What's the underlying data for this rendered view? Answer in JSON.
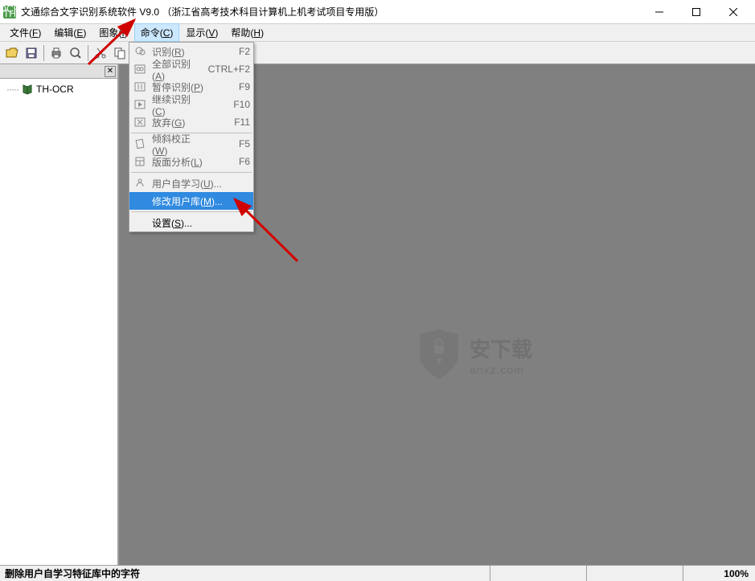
{
  "window": {
    "title": "文通综合文字识别系统软件 V9.0 （浙江省高考技术科目计算机上机考试项目专用版）"
  },
  "menu": {
    "items": [
      "文件(F)",
      "编辑(E)",
      "图象(I)",
      "命令(C)",
      "显示(V)",
      "帮助(H)"
    ],
    "active_index": 3
  },
  "dropdown": {
    "groups": [
      [
        {
          "label": "识别(R)",
          "shortcut": "F2",
          "icon": "recognize-icon"
        },
        {
          "label": "全部识别(A)",
          "shortcut": "CTRL+F2",
          "icon": "recognize-all-icon"
        },
        {
          "label": "暂停识别(P)",
          "shortcut": "F9",
          "icon": "pause-icon"
        },
        {
          "label": "继续识别(C)",
          "shortcut": "F10",
          "icon": "continue-icon"
        },
        {
          "label": "放弃(G)",
          "shortcut": "F11",
          "icon": "abort-icon"
        }
      ],
      [
        {
          "label": "倾斜校正(W)",
          "shortcut": "F5",
          "icon": "deskew-icon"
        },
        {
          "label": "版面分析(L)",
          "shortcut": "F6",
          "icon": "layout-icon"
        }
      ],
      [
        {
          "label": "用户自学习(U)...",
          "shortcut": "",
          "icon": "learn-icon"
        },
        {
          "label": "修改用户库(M)...",
          "shortcut": "",
          "icon": "",
          "highlighted": true
        }
      ],
      [
        {
          "label": "设置(S)...",
          "shortcut": "",
          "icon": "",
          "enabled": true
        }
      ]
    ]
  },
  "sidebar": {
    "tree_label": "TH-OCR"
  },
  "watermark": {
    "top": "安下载",
    "bottom": "anxz.com"
  },
  "statusbar": {
    "text": "删除用户自学习特征库中的字符",
    "zoom": "100%"
  }
}
